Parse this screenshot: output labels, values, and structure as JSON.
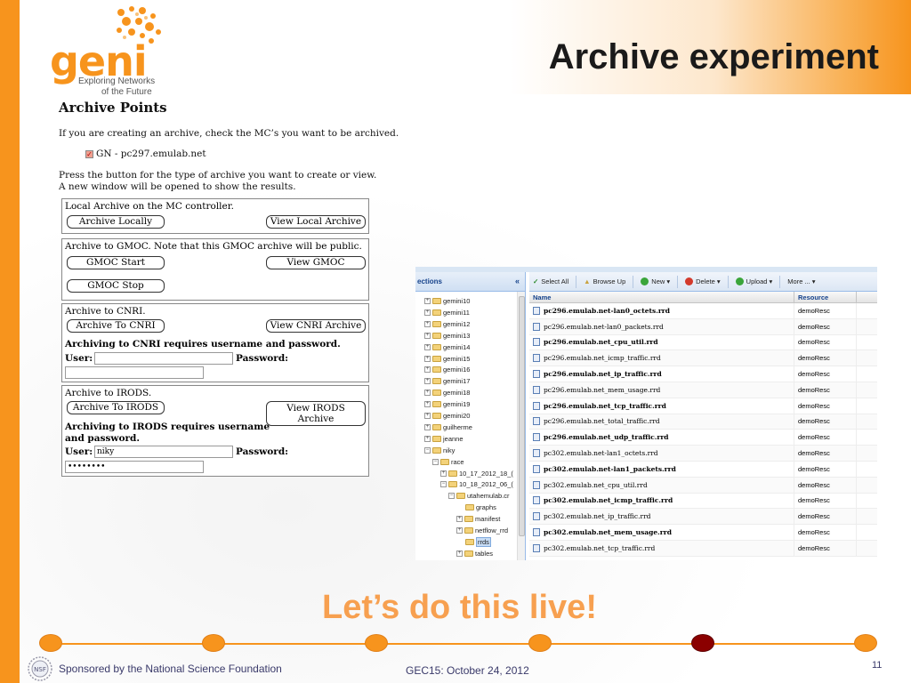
{
  "slide": {
    "title": "Archive experiment",
    "tagline": "Let’s do this live!",
    "logo": {
      "word": "geni",
      "tag1": "Exploring Networks",
      "tag2": "of the Future"
    },
    "footer": {
      "sponsor": "Sponsored by the National Science Foundation",
      "event": "GEC15: October 24, 2012",
      "page": "11"
    },
    "colors": {
      "accent": "#f7941d",
      "current_dot": "#8b0000",
      "tagline": "#f7a050"
    },
    "timeline_total": 6,
    "timeline_current": 5
  },
  "archive_points": {
    "title": "Archive Points",
    "intro": "If you are creating an archive, check the MC’s you want to be archived.",
    "checkbox_label": "GN - pc297.emulab.net",
    "checkbox_checked": true,
    "instruction1": "Press the button for the type of archive you want to create or view.",
    "instruction2": "A new window will be opened to show the results.",
    "local": {
      "heading": "Local Archive on the MC controller.",
      "archive_btn": "Archive Locally",
      "view_btn": "View Local Archive"
    },
    "gmoc": {
      "heading": "Archive to GMOC. Note that this GMOC archive will be public.",
      "start_btn": "GMOC Start",
      "view_btn": "View GMOC",
      "stop_btn": "GMOC Stop"
    },
    "cnri": {
      "heading": "Archive to CNRI.",
      "archive_btn": "Archive To CNRI",
      "view_btn": "View CNRI Archive",
      "note": "Archiving to CNRI requires username and password.",
      "user_label": "User:",
      "password_label": "Password:",
      "user_value": "",
      "password_value": ""
    },
    "irods": {
      "heading": "Archive to IRODS.",
      "archive_btn": "Archive To IRODS",
      "view_btn_line1": "View IRODS",
      "view_btn_line2": "Archive",
      "note_line1": "Archiving to IRODS requires username",
      "note_line2": "and password.",
      "user_label": "User:",
      "password_label": "Password:",
      "user_value": "niky",
      "password_value": "••••••••"
    }
  },
  "browser": {
    "left_header": "ections",
    "collapse_icon": "«",
    "tree": [
      {
        "label": "gemini10",
        "indent": 0,
        "expander": "+"
      },
      {
        "label": "gemini11",
        "indent": 0,
        "expander": "+"
      },
      {
        "label": "gemini12",
        "indent": 0,
        "expander": "+"
      },
      {
        "label": "gemini13",
        "indent": 0,
        "expander": "+"
      },
      {
        "label": "gemini14",
        "indent": 0,
        "expander": "+"
      },
      {
        "label": "gemini15",
        "indent": 0,
        "expander": "+"
      },
      {
        "label": "gemini16",
        "indent": 0,
        "expander": "+"
      },
      {
        "label": "gemini17",
        "indent": 0,
        "expander": "+"
      },
      {
        "label": "gemini18",
        "indent": 0,
        "expander": "+"
      },
      {
        "label": "gemini19",
        "indent": 0,
        "expander": "+"
      },
      {
        "label": "gemini20",
        "indent": 0,
        "expander": "+"
      },
      {
        "label": "guilherme",
        "indent": 0,
        "expander": "+"
      },
      {
        "label": "jeanne",
        "indent": 0,
        "expander": "+"
      },
      {
        "label": "niky",
        "indent": 0,
        "expander": "−"
      },
      {
        "label": "race",
        "indent": 1,
        "expander": "−"
      },
      {
        "label": "10_17_2012_18_(",
        "indent": 2,
        "expander": "+"
      },
      {
        "label": "10_18_2012_06_(",
        "indent": 2,
        "expander": "−"
      },
      {
        "label": "utahemulab.cr",
        "indent": 3,
        "expander": "−"
      },
      {
        "label": "graphs",
        "indent": 4,
        "expander": ""
      },
      {
        "label": "manifest",
        "indent": 4,
        "expander": "+"
      },
      {
        "label": "netflow_rrd",
        "indent": 4,
        "expander": "+"
      },
      {
        "label": "rrds",
        "indent": 4,
        "expander": "",
        "selected": true
      },
      {
        "label": "tables",
        "indent": 4,
        "expander": "+"
      }
    ],
    "toolbar": {
      "select_all": "Select All",
      "browse_up": "Browse Up",
      "new": "New ▾",
      "delete": "Delete ▾",
      "upload": "Upload ▾",
      "more": "More ... ▾"
    },
    "columns": {
      "name": "Name",
      "resource": "Resource"
    },
    "files": [
      {
        "name": "pc296.emulab.net-lan0_octets.rrd",
        "resource": "demoResc",
        "bold": true
      },
      {
        "name": "pc296.emulab.net-lan0_packets.rrd",
        "resource": "demoResc",
        "bold": false
      },
      {
        "name": "pc296.emulab.net_cpu_util.rrd",
        "resource": "demoResc",
        "bold": true
      },
      {
        "name": "pc296.emulab.net_icmp_traffic.rrd",
        "resource": "demoResc",
        "bold": false
      },
      {
        "name": "pc296.emulab.net_ip_traffic.rrd",
        "resource": "demoResc",
        "bold": true
      },
      {
        "name": "pc296.emulab.net_mem_usage.rrd",
        "resource": "demoResc",
        "bold": false
      },
      {
        "name": "pc296.emulab.net_tcp_traffic.rrd",
        "resource": "demoResc",
        "bold": true
      },
      {
        "name": "pc296.emulab.net_total_traffic.rrd",
        "resource": "demoResc",
        "bold": false
      },
      {
        "name": "pc296.emulab.net_udp_traffic.rrd",
        "resource": "demoResc",
        "bold": true
      },
      {
        "name": "pc302.emulab.net-lan1_octets.rrd",
        "resource": "demoResc",
        "bold": false
      },
      {
        "name": "pc302.emulab.net-lan1_packets.rrd",
        "resource": "demoResc",
        "bold": true
      },
      {
        "name": "pc302.emulab.net_cpu_util.rrd",
        "resource": "demoResc",
        "bold": false
      },
      {
        "name": "pc302.emulab.net_icmp_traffic.rrd",
        "resource": "demoResc",
        "bold": true
      },
      {
        "name": "pc302.emulab.net_ip_traffic.rrd",
        "resource": "demoResc",
        "bold": false
      },
      {
        "name": "pc302.emulab.net_mem_usage.rrd",
        "resource": "demoResc",
        "bold": true
      },
      {
        "name": "pc302.emulab.net_tcp_traffic.rrd",
        "resource": "demoResc",
        "bold": false
      }
    ]
  }
}
